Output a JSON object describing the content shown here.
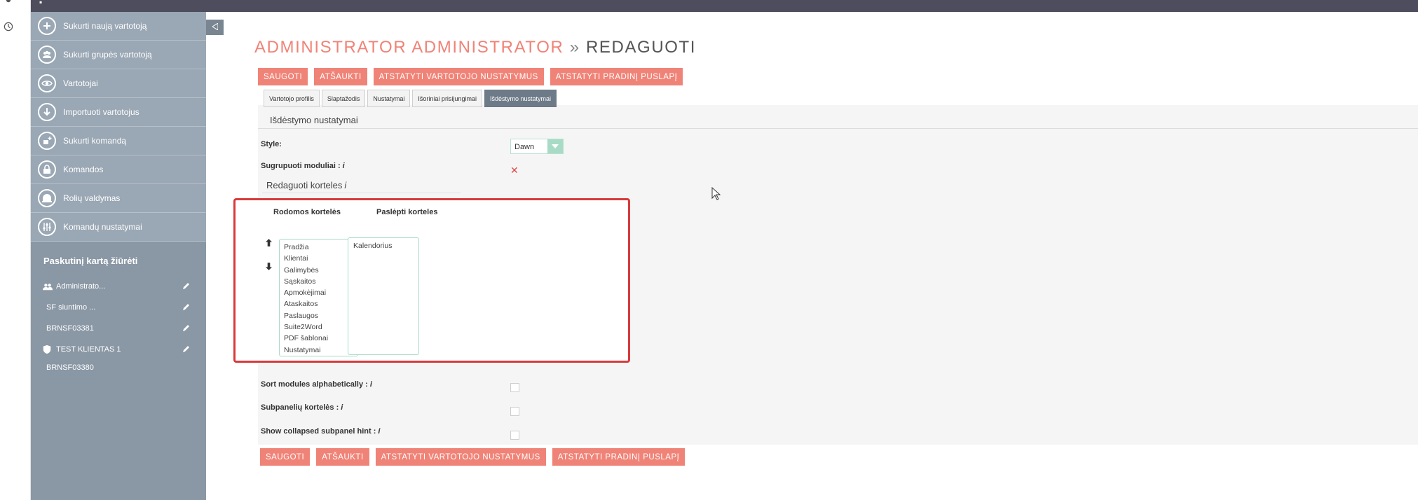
{
  "sidebar": {
    "menu": [
      {
        "label": "Sukurti naują vartotoją",
        "icon": "plus-icon"
      },
      {
        "label": "Sukurti grupės vartotoją",
        "icon": "group-icon"
      },
      {
        "label": "Vartotojai",
        "icon": "eye-icon"
      },
      {
        "label": "Importuoti vartotojus",
        "icon": "import-icon"
      },
      {
        "label": "Sukurti komandą",
        "icon": "add-team-icon"
      },
      {
        "label": "Komandos",
        "icon": "lock-icon"
      },
      {
        "label": "Rolių valdymas",
        "icon": "roles-icon"
      },
      {
        "label": "Komandų nustatymai",
        "icon": "sliders-icon"
      }
    ],
    "recent_title": "Paskutinį kartą žiūrėti",
    "recent": [
      {
        "label": "Administrato...",
        "icon": "users-icon",
        "editable": true
      },
      {
        "label": "SF siuntimo ...",
        "icon": "",
        "editable": true
      },
      {
        "label": "BRNSF03381",
        "icon": "",
        "editable": true
      },
      {
        "label": "TEST KLIENTAS 1",
        "icon": "shield-icon",
        "editable": true
      },
      {
        "label": "BRNSF03380",
        "icon": "",
        "editable": false
      }
    ]
  },
  "page": {
    "title_accent": "ADMINISTRATOR ADMINISTRATOR",
    "title_sep": "»",
    "title_rest": "REDAGUOTI"
  },
  "buttons": {
    "save": "SAUGOTI",
    "cancel": "ATŠAUKTI",
    "reset_user": "ATSTATYTI VARTOTOJO NUSTATYMUS",
    "reset_home": "ATSTATYTI PRADINĮ PUSLAPĮ"
  },
  "tabs": [
    {
      "label": "Vartotojo profilis",
      "active": false
    },
    {
      "label": "Slaptažodis",
      "active": false
    },
    {
      "label": "Nustatymai",
      "active": false
    },
    {
      "label": "Išoriniai prisijungimai",
      "active": false
    },
    {
      "label": "Išdėstymo nustatymai",
      "active": true
    }
  ],
  "layout_section": {
    "title": "Išdėstymo nustatymai",
    "style_label": "Style:",
    "style_value": "Dawn",
    "grouped_label": "Sugrupuoti moduliai :",
    "info_glyph": "i",
    "edit_tabs_heading": "Redaguoti korteles",
    "displayed_head": "Rodomos kortelės",
    "hidden_head": "Paslėpti korteles",
    "displayed_tabs": [
      "Pradžia",
      "Klientai",
      "Galimybės",
      "Sąskaitos",
      "Apmokėjimai",
      "Ataskaitos",
      "Paslaugos",
      "Suite2Word",
      "PDF šablonai",
      "Nustatymai"
    ],
    "hidden_tabs": [
      "Kalendorius"
    ],
    "sort_label": "Sort modules alphabetically :",
    "subpanel_label": "Subpanelių kortelės :",
    "collapsed_label": "Show collapsed subpanel hint :"
  },
  "colors": {
    "accent": "#f08377",
    "sidebar": "#8a97a5",
    "highlight": "#d9393a",
    "active_tab": "#6d7a87"
  }
}
